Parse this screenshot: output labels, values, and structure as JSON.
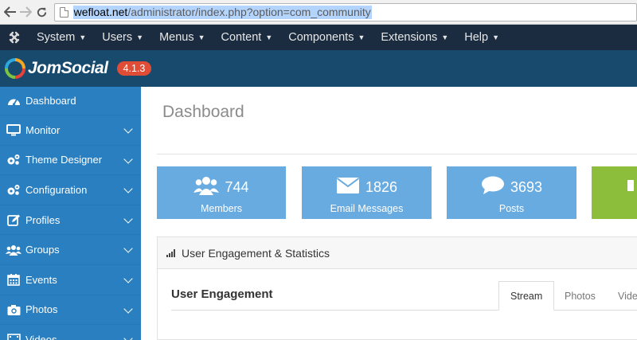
{
  "browser": {
    "url_domain": "wefloat.net",
    "url_path": "/administrator/index.php?option=com_community"
  },
  "admin_menu": {
    "items": [
      {
        "label": "System"
      },
      {
        "label": "Users"
      },
      {
        "label": "Menus"
      },
      {
        "label": "Content"
      },
      {
        "label": "Components"
      },
      {
        "label": "Extensions"
      },
      {
        "label": "Help"
      }
    ]
  },
  "header": {
    "logo_text": "JomSocial",
    "version": "4.1.3"
  },
  "sidebar": {
    "items": [
      {
        "label": "Dashboard",
        "icon": "dashboard-icon"
      },
      {
        "label": "Monitor",
        "icon": "monitor-icon"
      },
      {
        "label": "Theme Designer",
        "icon": "cogs-icon"
      },
      {
        "label": "Configuration",
        "icon": "cogs-icon"
      },
      {
        "label": "Profiles",
        "icon": "edit-icon"
      },
      {
        "label": "Groups",
        "icon": "users-icon"
      },
      {
        "label": "Events",
        "icon": "calendar-icon"
      },
      {
        "label": "Photos",
        "icon": "camera-icon"
      },
      {
        "label": "Videos",
        "icon": "video-icon"
      }
    ]
  },
  "main": {
    "title": "Dashboard",
    "stats": [
      {
        "value": "744",
        "label": "Members",
        "icon": "users-icon"
      },
      {
        "value": "1826",
        "label": "Email Messages",
        "icon": "envelope-icon"
      },
      {
        "value": "3693",
        "label": "Posts",
        "icon": "comment-icon"
      }
    ],
    "panel": {
      "title": "User Engagement & Statistics",
      "section_title": "User Engagement",
      "tabs": [
        {
          "label": "Stream"
        },
        {
          "label": "Photos"
        },
        {
          "label": "Vide"
        }
      ]
    }
  },
  "colors": {
    "sidebar": "#2a7fc1",
    "stat_blue": "#68abe0",
    "stat_green": "#8cbe3c",
    "admin_bar": "#1b2c40",
    "header": "#184a6d",
    "badge": "#e04d37"
  }
}
